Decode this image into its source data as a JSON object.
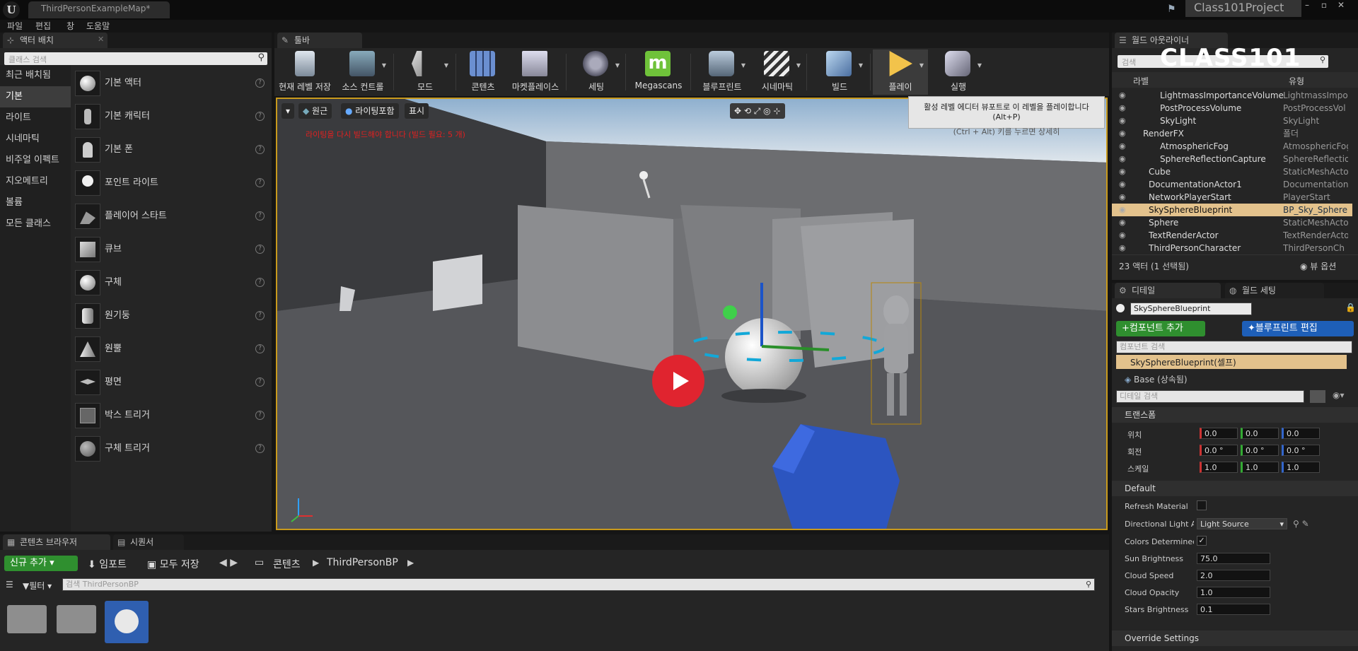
{
  "window": {
    "tab": "ThirdPersonExampleMap*",
    "project": "Class101Project",
    "logo_char": "U"
  },
  "menu": [
    "파일",
    "편집",
    "창",
    "도움말"
  ],
  "left_panel": {
    "tab": "액터 배치",
    "search_placeholder": "클래스 검색",
    "categories": [
      "최근 배치됨",
      "기본",
      "라이트",
      "시네마틱",
      "비주얼 이펙트",
      "지오메트리",
      "볼륨",
      "모든 클래스"
    ],
    "selected_category": "기본",
    "items": [
      "기본 액터",
      "기본 캐릭터",
      "기본 폰",
      "포인트 라이트",
      "플레이어 스타트",
      "큐브",
      "구체",
      "원기둥",
      "원뿔",
      "평면",
      "박스 트리거",
      "구체 트리거"
    ]
  },
  "toolbar": {
    "tab": "툴바",
    "buttons": [
      "현재 레벨 저장",
      "소스 컨트롤",
      "모드",
      "콘텐츠",
      "마켓플레이스",
      "세팅",
      "Megascans",
      "블루프린트",
      "시네마틱",
      "빌드",
      "플레이",
      "실행"
    ],
    "megascans_letter": "m",
    "tooltip_line1": "활성 레벨 에디터 뷰포트로 이 레벨을 플레이합니다 (Alt+P)",
    "tooltip_line2": "(Ctrl + Alt) 키를 누르면 상세히"
  },
  "viewport": {
    "btn_perspective": "원근",
    "btn_lit": "라이팅포함",
    "btn_show": "표시",
    "warning": "라이팅을 다시 빌드해야 합니다 (빌드 필요: 5 개)"
  },
  "outliner": {
    "tab": "월드 아웃라이너",
    "search_placeholder": "검색",
    "col_label": "라벨",
    "col_type": "유형",
    "rows": [
      {
        "name": "LightmassImportanceVolume",
        "type": "LightmassImpo"
      },
      {
        "name": "PostProcessVolume",
        "type": "PostProcessVol"
      },
      {
        "name": "SkyLight",
        "type": "SkyLight"
      },
      {
        "name": "RenderFX",
        "type": "폴더"
      },
      {
        "name": "AtmosphericFog",
        "type": "AtmosphericFog"
      },
      {
        "name": "SphereReflectionCapture",
        "type": "SphereReflectio"
      },
      {
        "name": "Cube",
        "type": "StaticMeshActor"
      },
      {
        "name": "DocumentationActor1",
        "type": "DocumentationA"
      },
      {
        "name": "NetworkPlayerStart",
        "type": "PlayerStart"
      },
      {
        "name": "SkySphereBlueprint",
        "type": "BP_Sky_Sphere"
      },
      {
        "name": "Sphere",
        "type": "StaticMeshActor"
      },
      {
        "name": "TextRenderActor",
        "type": "TextRenderActor"
      },
      {
        "name": "ThirdPersonCharacter",
        "type": "ThirdPersonCh"
      }
    ],
    "status": "23 액터 (1 선택됨)",
    "view_options": "뷰 옵션"
  },
  "details": {
    "tab_details": "디테일",
    "tab_world": "월드 세팅",
    "object_name": "SkySphereBlueprint",
    "add_component": "+컴포넌트 추가",
    "edit_bp": "블루프린트 편집",
    "component_search": "컴포넌트 검색",
    "self_item": "SkySphereBlueprint(셀프)",
    "base_item": "Base (상속됨)",
    "details_search": "디테일 검색",
    "transform": "트랜스폼",
    "loc": "위치",
    "rot": "회전",
    "scale": "스케일",
    "loc_vals": [
      "0.0",
      "0.0",
      "0.0"
    ],
    "rot_vals": [
      "0.0 °",
      "0.0 °",
      "0.0 °"
    ],
    "scale_vals": [
      "1.0",
      "1.0",
      "1.0"
    ],
    "default_section": "Default",
    "refresh_material": "Refresh Material",
    "dir_light": "Directional Light Ac",
    "dir_light_val": "Light Source",
    "colors_determined": "Colors Determined I",
    "sun_brightness": "Sun Brightness",
    "sun_val": "75.0",
    "cloud_speed": "Cloud Speed",
    "cloud_speed_val": "2.0",
    "cloud_opacity": "Cloud Opacity",
    "cloud_opacity_val": "1.0",
    "stars_brightness": "Stars Brightness",
    "stars_val": "0.1",
    "override": "Override Settings"
  },
  "content_browser": {
    "tab1": "콘텐츠 브라우저",
    "tab2": "시퀀서",
    "add_new": "신규 추가",
    "import": "임포트",
    "save_all": "모두 저장",
    "path_root": "콘텐츠",
    "path_leaf": "ThirdPersonBP",
    "filter": "필터",
    "search_placeholder": "검색 ThirdPersonBP"
  },
  "watermark": "CLASS101"
}
